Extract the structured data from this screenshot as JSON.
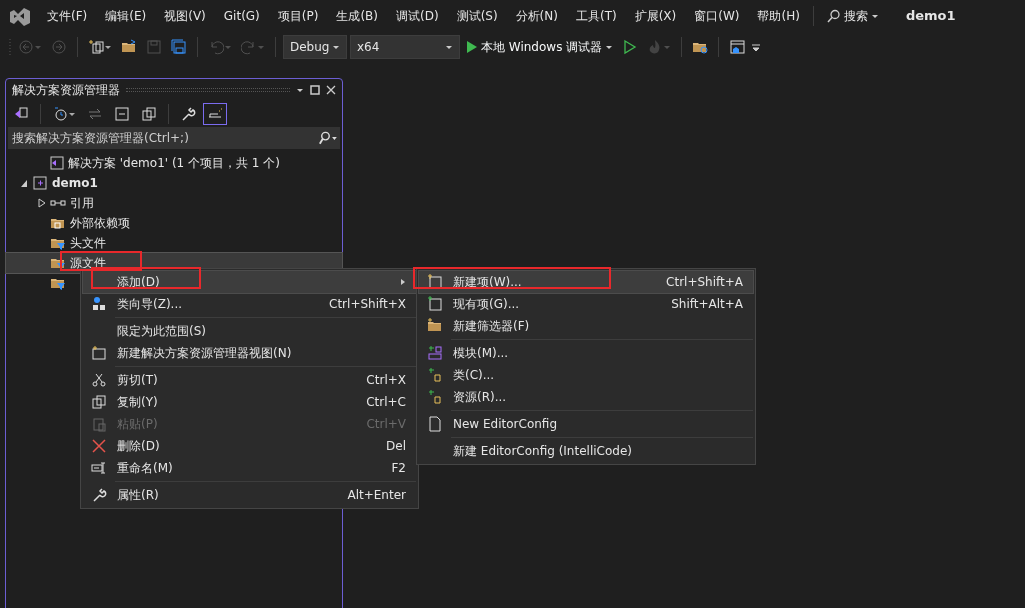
{
  "menu_bar": {
    "items": [
      "文件(F)",
      "编辑(E)",
      "视图(V)",
      "Git(G)",
      "项目(P)",
      "生成(B)",
      "调试(D)",
      "测试(S)",
      "分析(N)",
      "工具(T)",
      "扩展(X)",
      "窗口(W)",
      "帮助(H)"
    ],
    "search": "搜索",
    "title": "demo1"
  },
  "toolbar": {
    "buttons": [
      {
        "disabled": true
      },
      {
        "disabled": true
      },
      {
        "disabled": false
      },
      {
        "disabled": false
      },
      {
        "disabled": true
      },
      {
        "disabled": false
      },
      {
        "disabled": true
      },
      {
        "disabled": true
      }
    ],
    "configuration": "Debug",
    "platform": "x64",
    "run_label": "本地 Windows 调试器",
    "extra_buttons": [
      {
        "disabled": false
      },
      {
        "disabled": true
      },
      {
        "disabled": false
      },
      {
        "disabled": false
      }
    ]
  },
  "solution_explorer": {
    "title": "解决方案资源管理器",
    "tools": [
      {
        "on": false
      },
      {
        "on": false
      },
      {
        "on": false
      },
      {
        "on": false
      },
      {
        "on": false
      },
      {
        "on": false
      },
      {
        "on": true
      }
    ],
    "search": {
      "placeholder": "搜索解决方案资源管理器(Ctrl+;)"
    },
    "tree": [
      {
        "label": "解决方案 'demo1' (1 个项目，共 1 个)",
        "selected": false,
        "highlighted": false
      },
      {
        "label": "demo1",
        "selected": false,
        "highlighted": false,
        "expanded": true,
        "children": [
          {
            "label": "引用",
            "selected": false,
            "highlighted": false,
            "expanded": false
          },
          {
            "label": "外部依赖项",
            "selected": false,
            "highlighted": false
          },
          {
            "label": "头文件",
            "selected": false,
            "highlighted": false
          },
          {
            "label": "源文件",
            "selected": true,
            "highlighted": true
          },
          {
            "selected": false,
            "highlighted": false
          }
        ]
      }
    ]
  },
  "context_menu": [
    {
      "kind": "item",
      "label": "添加(D)",
      "submenu": true,
      "selected": true,
      "highlighted": true,
      "disabled": false
    },
    {
      "kind": "item",
      "label": "类向导(Z)...",
      "shortcut": "Ctrl+Shift+X",
      "submenu": false,
      "selected": false,
      "highlighted": false,
      "disabled": false
    },
    {
      "kind": "separator"
    },
    {
      "kind": "item",
      "label": "限定为此范围(S)",
      "submenu": false,
      "selected": false,
      "highlighted": false,
      "disabled": false
    },
    {
      "kind": "item",
      "label": "新建解决方案资源管理器视图(N)",
      "submenu": false,
      "selected": false,
      "highlighted": false,
      "disabled": false
    },
    {
      "kind": "separator"
    },
    {
      "kind": "item",
      "label": "剪切(T)",
      "shortcut": "Ctrl+X",
      "submenu": false,
      "selected": false,
      "highlighted": false,
      "disabled": false
    },
    {
      "kind": "item",
      "label": "复制(Y)",
      "shortcut": "Ctrl+C",
      "submenu": false,
      "selected": false,
      "highlighted": false,
      "disabled": false
    },
    {
      "kind": "item",
      "label": "粘贴(P)",
      "shortcut": "Ctrl+V",
      "submenu": false,
      "selected": false,
      "highlighted": false,
      "disabled": true
    },
    {
      "kind": "item",
      "label": "删除(D)",
      "shortcut": "Del",
      "submenu": false,
      "selected": false,
      "highlighted": false,
      "disabled": false
    },
    {
      "kind": "item",
      "label": "重命名(M)",
      "shortcut": "F2",
      "submenu": false,
      "selected": false,
      "highlighted": false,
      "disabled": false
    },
    {
      "kind": "separator"
    },
    {
      "kind": "item",
      "label": "属性(R)",
      "shortcut": "Alt+Enter",
      "submenu": false,
      "selected": false,
      "highlighted": false,
      "disabled": false
    }
  ],
  "add_submenu": [
    {
      "kind": "item",
      "label": "新建项(W)...",
      "shortcut": "Ctrl+Shift+A",
      "selected": true,
      "highlighted": true,
      "disabled": false
    },
    {
      "kind": "item",
      "label": "现有项(G)...",
      "shortcut": "Shift+Alt+A",
      "selected": false,
      "highlighted": false,
      "disabled": false
    },
    {
      "kind": "item",
      "label": "新建筛选器(F)",
      "selected": false,
      "highlighted": false,
      "disabled": false
    },
    {
      "kind": "separator"
    },
    {
      "kind": "item",
      "label": "模块(M)...",
      "selected": false,
      "highlighted": false,
      "disabled": false
    },
    {
      "kind": "item",
      "label": "类(C)...",
      "selected": false,
      "highlighted": false,
      "disabled": false
    },
    {
      "kind": "item",
      "label": "资源(R)...",
      "selected": false,
      "highlighted": false,
      "disabled": false
    },
    {
      "kind": "separator"
    },
    {
      "kind": "item",
      "label": "New EditorConfig",
      "selected": false,
      "highlighted": false,
      "disabled": false
    },
    {
      "kind": "separator"
    },
    {
      "kind": "item",
      "label": "新建 EditorConfig (IntelliCode)",
      "selected": false,
      "highlighted": false,
      "disabled": false
    }
  ]
}
